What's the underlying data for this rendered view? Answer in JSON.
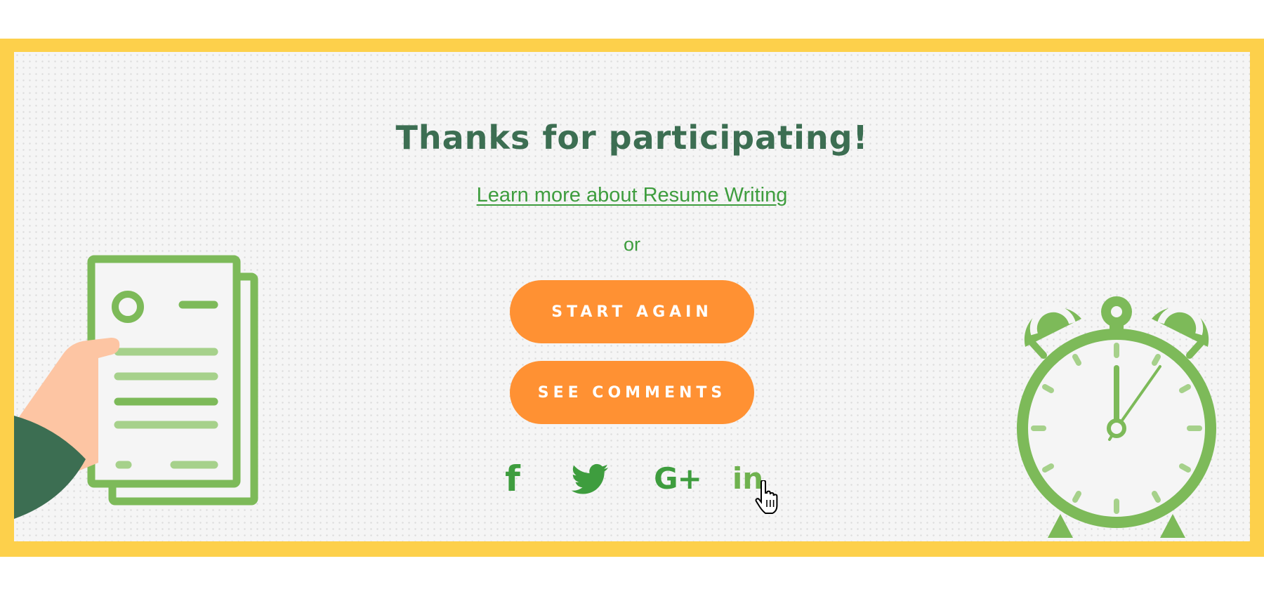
{
  "page": {
    "title": "Thanks for participating!",
    "learn_link": "Learn more about Resume Writing",
    "or_text": "or"
  },
  "buttons": {
    "start_again": "START AGAIN",
    "see_comments": "SEE COMMENTS"
  },
  "social": [
    {
      "name": "facebook",
      "glyph": "f"
    },
    {
      "name": "twitter",
      "glyph": ""
    },
    {
      "name": "google-plus",
      "glyph": "G+"
    },
    {
      "name": "linkedin",
      "glyph": "in"
    }
  ],
  "icons": [
    "resume-document-icon",
    "hand-icon",
    "alarm-clock-icon",
    "pointer-cursor-icon"
  ],
  "colors": {
    "frame": "#fdd04b",
    "panel": "#f5f5f5",
    "title": "#3c6e52",
    "link": "#3e9d3e",
    "button": "#ff9133",
    "illustration": "#7dba59",
    "sleeve": "#3c6e52",
    "skin": "#fdc5a3"
  }
}
